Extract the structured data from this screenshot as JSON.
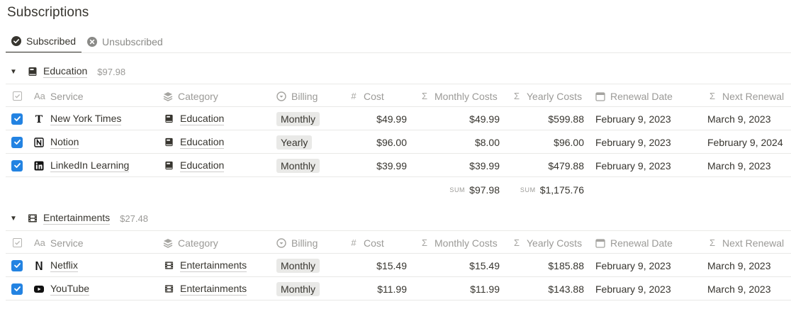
{
  "page": {
    "title": "Subscriptions"
  },
  "tabs": [
    {
      "label": "Subscribed",
      "active": true,
      "icon": "check-circle-icon"
    },
    {
      "label": "Unsubscribed",
      "active": false,
      "icon": "x-circle-icon"
    }
  ],
  "columns": {
    "service": "Service",
    "category": "Category",
    "billing": "Billing",
    "cost": "Cost",
    "monthly": "Monthly Costs",
    "yearly": "Yearly Costs",
    "renewal": "Renewal Date",
    "next": "Next Renewal"
  },
  "column_icons": {
    "service": "Aa",
    "cost": "#",
    "monthly": "Σ",
    "yearly": "Σ",
    "next": "Σ"
  },
  "sum_label": "SUM",
  "groups": [
    {
      "name": "Education",
      "sum": "$97.98",
      "rows": [
        {
          "service": "New York Times",
          "icon": "nyt-icon",
          "category": "Education",
          "billing": "Monthly",
          "cost": "$49.99",
          "monthly": "$49.99",
          "yearly": "$599.88",
          "renewal": "February 9, 2023",
          "next": "March 9, 2023"
        },
        {
          "service": "Notion",
          "icon": "notion-icon",
          "category": "Education",
          "billing": "Yearly",
          "cost": "$96.00",
          "monthly": "$8.00",
          "yearly": "$96.00",
          "renewal": "February 9, 2023",
          "next": "February 9, 2024"
        },
        {
          "service": "LinkedIn Learning",
          "icon": "linkedin-icon",
          "category": "Education",
          "billing": "Monthly",
          "cost": "$39.99",
          "monthly": "$39.99",
          "yearly": "$479.88",
          "renewal": "February 9, 2023",
          "next": "March 9, 2023"
        }
      ],
      "totals": {
        "monthly": "$97.98",
        "yearly": "$1,175.76"
      }
    },
    {
      "name": "Entertainments",
      "sum": "$27.48",
      "rows": [
        {
          "service": "Netflix",
          "icon": "netflix-icon",
          "category": "Entertainments",
          "billing": "Monthly",
          "cost": "$15.49",
          "monthly": "$15.49",
          "yearly": "$185.88",
          "renewal": "February 9, 2023",
          "next": "March 9, 2023"
        },
        {
          "service": "YouTube",
          "icon": "youtube-icon",
          "category": "Entertainments",
          "billing": "Monthly",
          "cost": "$11.99",
          "monthly": "$11.99",
          "yearly": "$143.88",
          "renewal": "February 9, 2023",
          "next": "March 9, 2023"
        }
      ]
    }
  ],
  "colors": {
    "accent": "#2383e2",
    "text": "#37352f",
    "muted": "#9b9a97",
    "border": "#e9e9e7",
    "pill": "#e9e9e7"
  }
}
